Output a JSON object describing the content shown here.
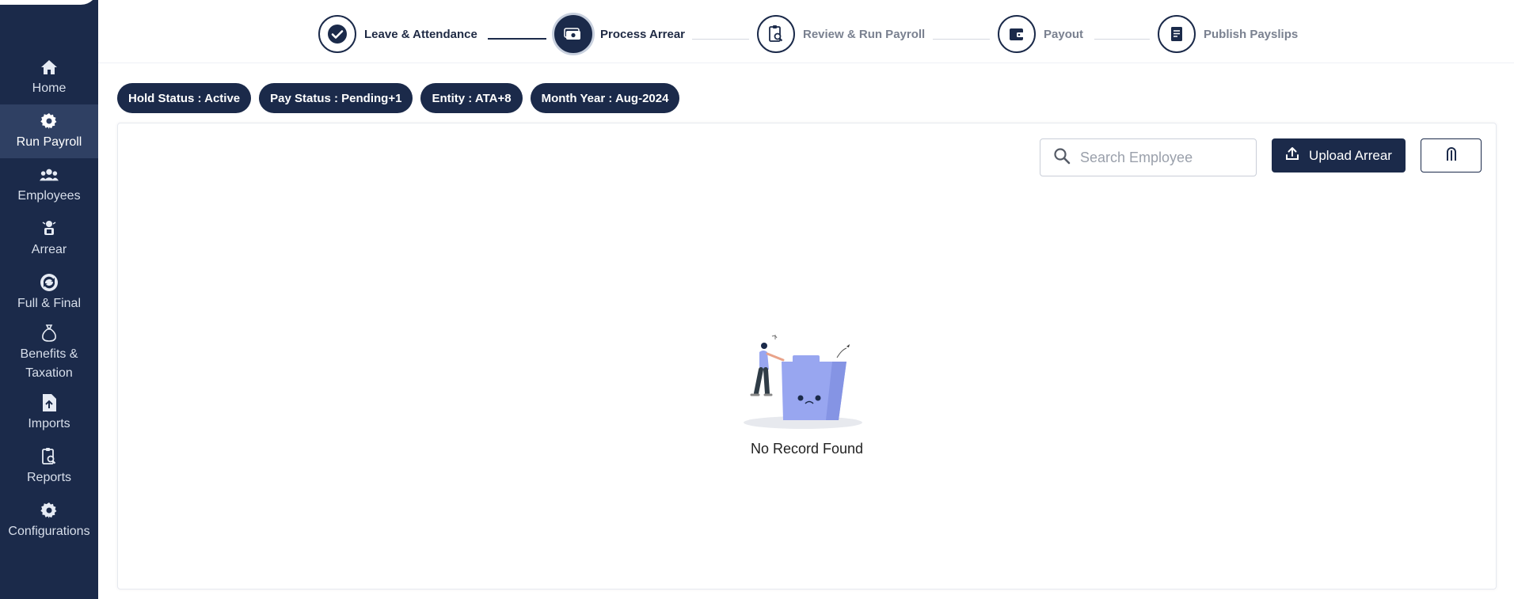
{
  "sidebar": {
    "items": [
      {
        "label": "Home",
        "icon": "home-icon"
      },
      {
        "label": "Run Payroll",
        "icon": "gear-icon",
        "active": true
      },
      {
        "label": "Employees",
        "icon": "users-icon"
      },
      {
        "label": "Arrear",
        "icon": "arrear-icon"
      },
      {
        "label": "Full & Final",
        "icon": "refresh-icon"
      },
      {
        "label": "Benefits & Taxation",
        "icon": "money-bag-icon"
      },
      {
        "label": "Imports",
        "icon": "file-upload-icon"
      },
      {
        "label": "Reports",
        "icon": "report-icon"
      },
      {
        "label": "Configurations",
        "icon": "settings-icon"
      }
    ]
  },
  "stepper": {
    "steps": [
      {
        "label": "Leave & Attendance",
        "state": "done",
        "icon": "check-icon"
      },
      {
        "label": "Process Arrear",
        "state": "current",
        "icon": "money-icon"
      },
      {
        "label": "Review & Run Payroll",
        "state": "pending",
        "icon": "clipboard-search-icon"
      },
      {
        "label": "Payout",
        "state": "pending",
        "icon": "wallet-icon"
      },
      {
        "label": "Publish Payslips",
        "state": "pending",
        "icon": "payslip-icon"
      }
    ]
  },
  "filters": [
    "Hold Status : Active",
    "Pay Status : Pending+1",
    "Entity : ATA+8",
    "Month Year : Aug-2024"
  ],
  "toolbar": {
    "search_placeholder": "Search Employee",
    "search_value": "",
    "upload_label": "Upload Arrear"
  },
  "empty_state": {
    "message": "No Record Found"
  },
  "colors": {
    "primary": "#1b2a4a",
    "illustration": "#98a6f0"
  }
}
